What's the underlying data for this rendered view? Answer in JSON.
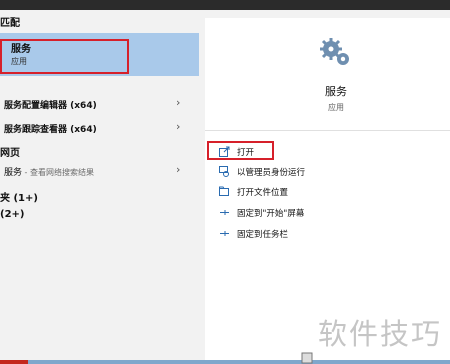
{
  "left": {
    "best_match_header": "匹配",
    "best_match": {
      "title": "服务",
      "subtitle": "应用"
    },
    "apps_header": "",
    "items": [
      {
        "label": "服务配置编辑器 (x64)",
        "chevron": "›"
      },
      {
        "label": "服务跟踪查看器 (x64)",
        "chevron": "›"
      }
    ],
    "web_header": "网页",
    "web_item": {
      "label": "服务",
      "suffix": " - 查看网络搜索结果",
      "chevron": "›"
    },
    "folders_header": "夹 (1+)",
    "docs_header": "(2+)"
  },
  "right": {
    "app_icon": "gears-icon",
    "app_title": "服务",
    "app_subtitle": "应用",
    "actions": [
      {
        "label": "打开",
        "icon": "open-icon"
      },
      {
        "label": "以管理员身份运行",
        "icon": "shield-run-icon"
      },
      {
        "label": "打开文件位置",
        "icon": "folder-icon"
      },
      {
        "label": "固定到\"开始\"屏幕",
        "icon": "pin-icon"
      },
      {
        "label": "固定到任务栏",
        "icon": "pin-icon"
      }
    ]
  },
  "watermark": "软件技巧",
  "colors": {
    "selection": "#a9c9ea",
    "highlight_outline": "#d6202a",
    "taskbar": "#7fa7cc"
  }
}
